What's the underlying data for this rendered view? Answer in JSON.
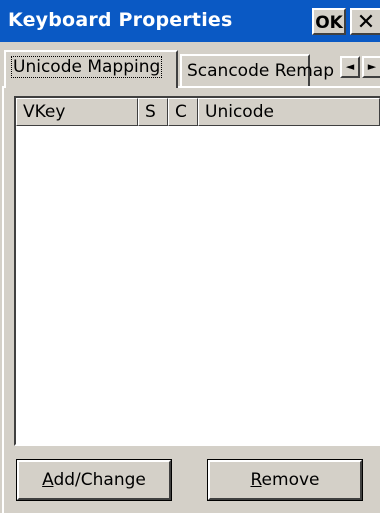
{
  "window": {
    "title": "Keyboard Properties",
    "ok_label": "OK",
    "close_glyph": "✕"
  },
  "tabs": [
    {
      "label": "Unicode Mapping",
      "selected": true
    },
    {
      "label": "Scancode Remap",
      "selected": false
    }
  ],
  "tab_scroll": {
    "left_glyph": "◄",
    "right_glyph": "►"
  },
  "table": {
    "columns": [
      "VKey",
      "S",
      "C",
      "Unicode"
    ],
    "rows": []
  },
  "buttons": {
    "add_change": {
      "mnemonic": "A",
      "rest": "dd/Change"
    },
    "remove": {
      "mnemonic": "R",
      "rest": "emove"
    }
  },
  "colors": {
    "titlebar": "#0a59c4",
    "face": "#d4d0c8"
  }
}
